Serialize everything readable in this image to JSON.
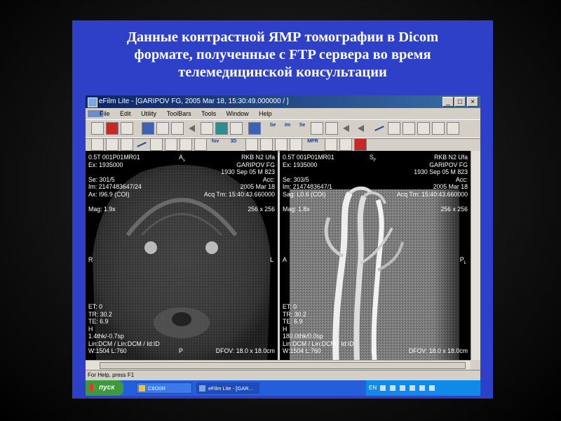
{
  "slide": {
    "title_line1": "Данные контрастной ЯМР томографии в Dicom",
    "title_line2": "формате, полученные с FTP сервера во время",
    "title_line3": "телемедицинской консультации"
  },
  "window": {
    "title": "eFilm Lite - [GARIPOV FG, 2005 Mar 18, 15:30:49.000000  /  ]",
    "min_label": "_",
    "max_label": "□",
    "close_label": "×"
  },
  "menu": [
    "File",
    "Edit",
    "Utility",
    "ToolBars",
    "Tools",
    "Window",
    "Help"
  ],
  "toolbar": {
    "se_label": "Se",
    "im_label": "Im",
    "se2_label": "Se",
    "im2_label": "Im",
    "fov_label": "fov",
    "d3_label": "3D",
    "mpr_label": "MPR"
  },
  "left_viewer": {
    "top_left": [
      "0.5T 001P01MR01",
      "Ex: 1935000",
      "",
      "Se:  301/5",
      "Im: 2147483647/24",
      "Ax: I96.9 (COI)",
      "",
      "Mag: 1.9x"
    ],
    "top_center": "A",
    "top_center_sub": "s",
    "top_right": [
      "RKB N2 Ufa",
      "GARIPOV FG",
      "1930 Sep 05  M  823",
      "Acc:",
      "2005 Mar 18",
      "Acq Tm: 15:40:43.660000",
      "",
      "256 x 256"
    ],
    "side_left": "R",
    "side_right": "L",
    "bottom_left": [
      "ET: 0",
      "TR: 30.2",
      "TE: 6.9",
      "H",
      "1.4thk/-0.7sp",
      "Lin:DCM / Lin:DCM / Id:ID",
      "W:1504  L:760"
    ],
    "bottom_center": "P",
    "bottom_right": "DFOV: 18.0 x 18.0cm"
  },
  "right_viewer": {
    "top_left": [
      "0.5T 001P01MR01",
      "Ex: 1935000",
      "",
      "Se:  303/5",
      "Im: 2147483647/1",
      "Sag: L0.6 (COI)",
      "",
      "Mag: 1.8x"
    ],
    "top_center": "S",
    "top_center_sub": "F",
    "top_right": [
      "RKB N2 Ufa",
      "GARIPOV FG",
      "1930 Sep 05  M  823",
      "Acc:",
      "2005 Mar 18",
      "Acq Tm: 15:40:43.660000",
      "",
      "256 x 256"
    ],
    "side_left": "A",
    "side_right": "P",
    "side_right_sub": "L",
    "bottom_left": [
      "ET: 0",
      "TR: 30.2",
      "TE: 6.9",
      "H",
      "180.0thk/0.0sp",
      "Lin:DCM / Lin:DCM / Id:ID",
      "W:1504  L:760"
    ],
    "bottom_center": "I",
    "bottom_center_sub": "n",
    "bottom_right": "DFOV: 18.0 x 18.0cm"
  },
  "status": {
    "text": "For Help, press F1"
  },
  "taskbar": {
    "start_label": "пуск",
    "tasks": [
      "C8O0R",
      "eFilm Lite - [GAR..."
    ],
    "tray_text": "EN"
  }
}
